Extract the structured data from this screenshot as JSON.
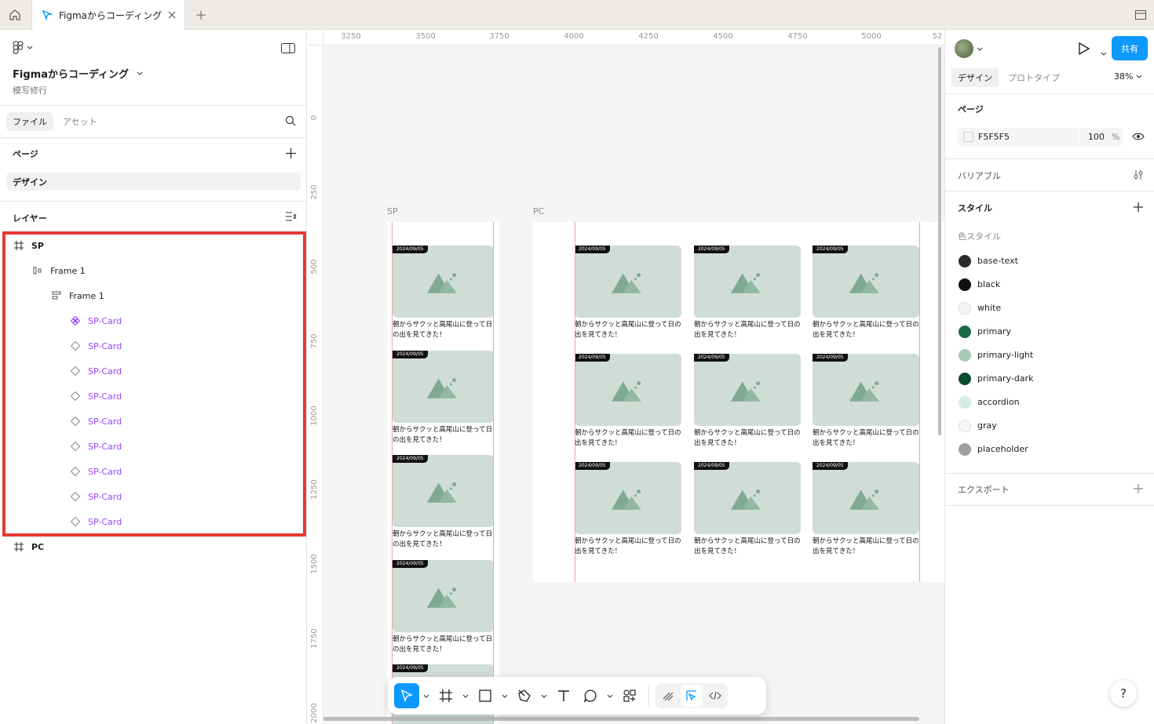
{
  "tabbar": {
    "tab_title": "Figmaからコーディング"
  },
  "left": {
    "file_name": "Figmaからコーディング",
    "file_subtitle": "模写修行",
    "tab_file": "ファイル",
    "tab_assets": "アセット",
    "pages_label": "ページ",
    "page_design": "デザイン",
    "layers_label": "レイヤー",
    "layers": [
      {
        "label": "SP"
      },
      {
        "label": "Frame 1"
      },
      {
        "label": "Frame 1"
      },
      {
        "label": "SP-Card"
      },
      {
        "label": "SP-Card"
      },
      {
        "label": "SP-Card"
      },
      {
        "label": "SP-Card"
      },
      {
        "label": "SP-Card"
      },
      {
        "label": "SP-Card"
      },
      {
        "label": "SP-Card"
      },
      {
        "label": "SP-Card"
      },
      {
        "label": "SP-Card"
      },
      {
        "label": "PC"
      }
    ]
  },
  "canvas": {
    "ruler_top": [
      "3250",
      "3500",
      "3750",
      "4000",
      "4250",
      "4500",
      "4750",
      "5000",
      "52"
    ],
    "ruler_left": [
      "0",
      "250",
      "500",
      "750",
      "1000",
      "1250",
      "1500",
      "1750",
      "2000"
    ],
    "frame_sp": "SP",
    "frame_pc": "PC",
    "card_date": "2024/09/05",
    "sp_card_title_1": "朝からサクッと高尾山に登って日",
    "sp_card_title_2": "の出を見てきた！",
    "pc_card_title_1": "朝からサクッと高尾山に登って日の",
    "pc_card_title_2": "出を見てきた！"
  },
  "right": {
    "tab_design": "デザイン",
    "tab_prototype": "プロトタイプ",
    "zoom": "38%",
    "share": "共有",
    "page_section": "ページ",
    "page_color": "F5F5F5",
    "page_opacity": "100",
    "percent": "%",
    "variables": "バリアブル",
    "styles": "スタイル",
    "color_styles": "色スタイル",
    "colors": [
      {
        "name": "base-text",
        "hex": "#2b2b2b"
      },
      {
        "name": "black",
        "hex": "#111111"
      },
      {
        "name": "white",
        "hex": "#f4f4f4"
      },
      {
        "name": "primary",
        "hex": "#1a6b45"
      },
      {
        "name": "primary-light",
        "hex": "#a9c9b8"
      },
      {
        "name": "primary-dark",
        "hex": "#0b4a2c"
      },
      {
        "name": "accordion",
        "hex": "#d6ece2"
      },
      {
        "name": "gray",
        "hex": "#f6f6f6"
      },
      {
        "name": "placeholder",
        "hex": "#9e9e9e"
      }
    ],
    "export": "エクスポート"
  },
  "help": "?"
}
